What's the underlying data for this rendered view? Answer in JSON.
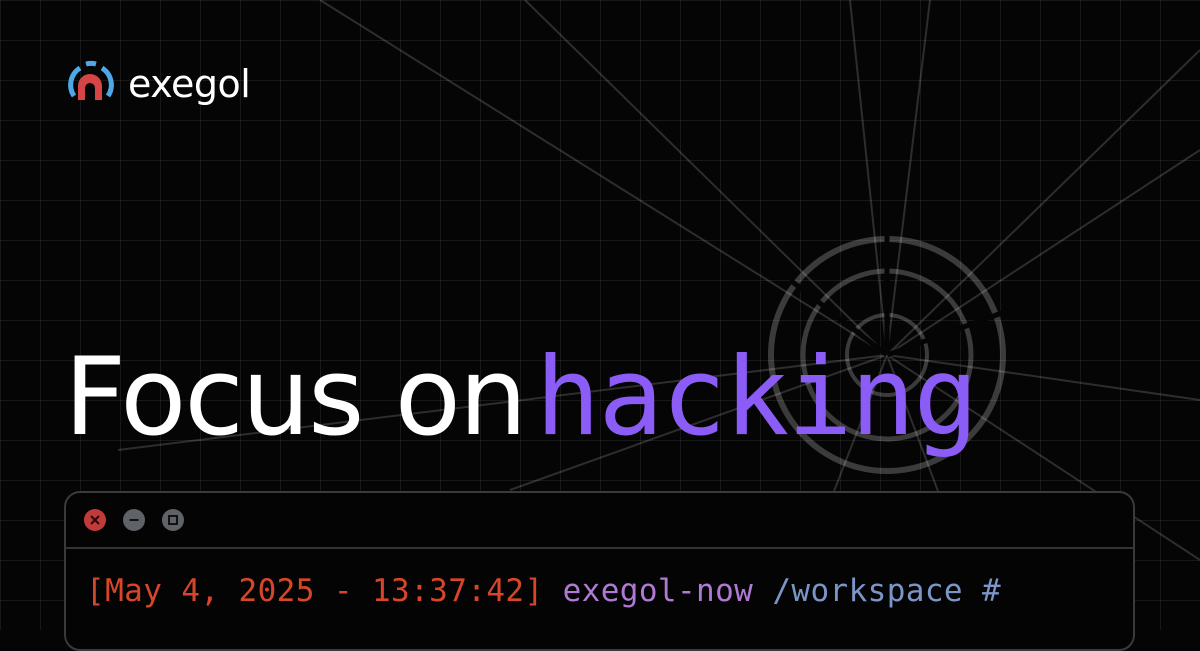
{
  "brand": {
    "name": "exegol",
    "icon": "exegol-logo-icon",
    "colors": {
      "ring": "#4ea7e6",
      "core": "#d64545"
    }
  },
  "headline": {
    "text": "Focus on",
    "highlight": "hacking",
    "highlight_color": "#8b5cf6"
  },
  "terminal": {
    "controls": [
      "close-icon",
      "minimize-icon",
      "maximize-icon"
    ],
    "prompt": {
      "timestamp": "[May 4, 2025 - 13:37:42]",
      "host": "exegol-now",
      "path": "/workspace #"
    },
    "colors": {
      "timestamp": "#d8462a",
      "host": "#b079d6",
      "path": "#7c95c8"
    }
  }
}
